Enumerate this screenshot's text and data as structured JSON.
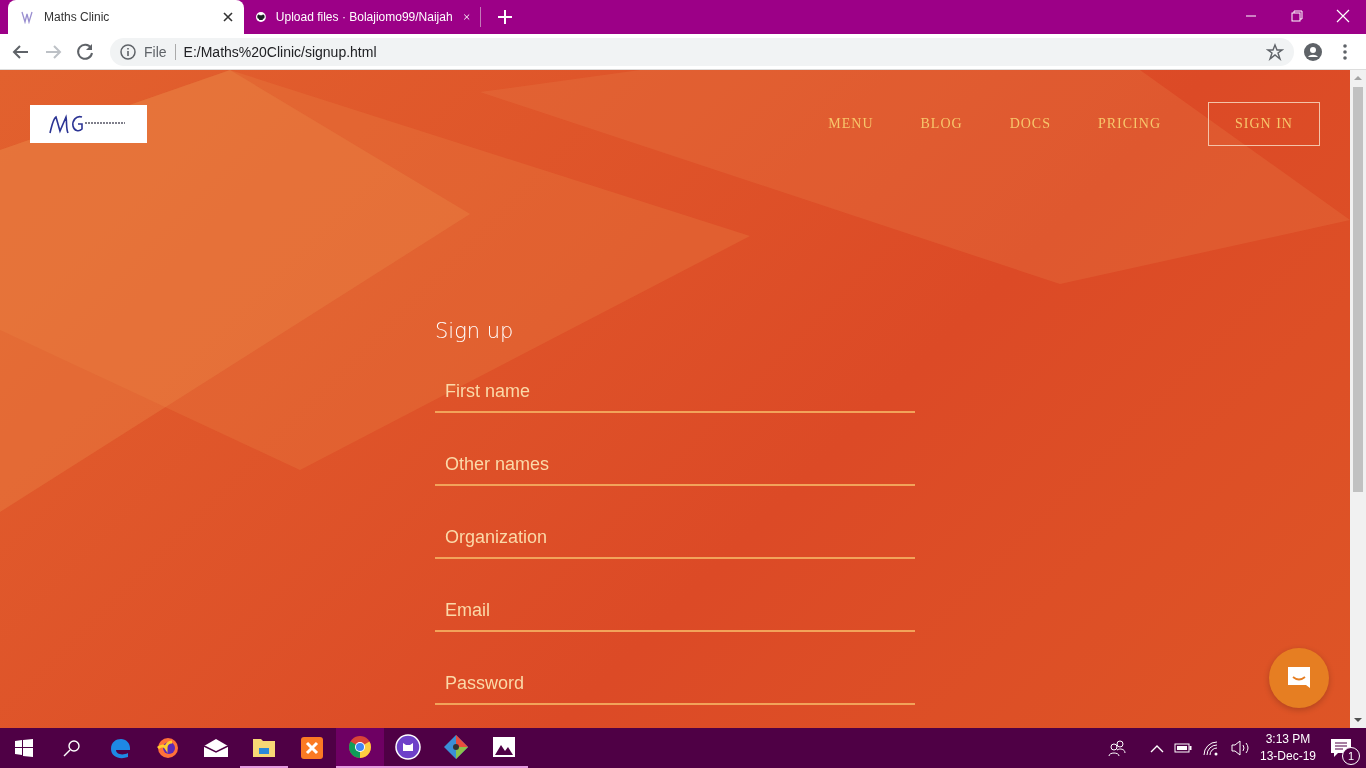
{
  "browser": {
    "tabs": [
      {
        "title": "Maths Clinic",
        "selected": true,
        "kind": "site"
      },
      {
        "title": "Upload files · Bolajiomo99/Naijah",
        "selected": false,
        "kind": "github"
      }
    ],
    "address": {
      "scheme": "File",
      "url": "E:/Maths%20Clinic/signup.html"
    }
  },
  "nav": {
    "items": [
      "MENU",
      "BLOG",
      "DOCS",
      "PRICING"
    ],
    "sign_in": "SIGN IN"
  },
  "form": {
    "title": "Sign up",
    "fields": [
      {
        "placeholder": "First name"
      },
      {
        "placeholder": "Other names"
      },
      {
        "placeholder": "Organization"
      },
      {
        "placeholder": "Email"
      },
      {
        "placeholder": "Password"
      }
    ]
  },
  "taskbar": {
    "apps": [
      {
        "kind": "edge",
        "running": false,
        "selected": false
      },
      {
        "kind": "firefox",
        "running": false,
        "selected": false
      },
      {
        "kind": "mail",
        "running": false,
        "selected": false
      },
      {
        "kind": "explorer",
        "running": true,
        "selected": false
      },
      {
        "kind": "xampp",
        "running": false,
        "selected": false
      },
      {
        "kind": "chrome",
        "running": true,
        "selected": true
      },
      {
        "kind": "github",
        "running": true,
        "selected": false
      },
      {
        "kind": "git",
        "running": true,
        "selected": false
      },
      {
        "kind": "photos",
        "running": true,
        "selected": false
      }
    ],
    "time": "3:13 PM",
    "date": "13-Dec-19",
    "notifications": "1"
  }
}
